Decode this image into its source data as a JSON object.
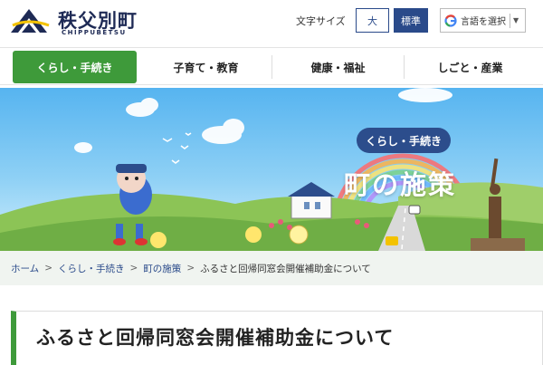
{
  "header": {
    "site_title": "秩父別町",
    "site_subtitle": "CHIPPUBETSU",
    "font_size_label": "文字サイズ",
    "font_large_label": "大",
    "font_standard_label": "標準",
    "language_label": "言語を選択",
    "language_arrow": "▼"
  },
  "nav": {
    "items": [
      {
        "label": "くらし・手続き",
        "active": true
      },
      {
        "label": "子育て・教育"
      },
      {
        "label": "健康・福祉"
      },
      {
        "label": "しごと・産業"
      }
    ]
  },
  "hero": {
    "badge": "くらし・手続き",
    "title": "町の施策"
  },
  "breadcrumb": {
    "items": [
      "ホーム",
      "くらし・手続き",
      "町の施策",
      "ふるさと回帰同窓会開催補助金について"
    ],
    "separator": ">"
  },
  "page": {
    "title": "ふるさと回帰同窓会開催補助金について"
  },
  "colors": {
    "brand_navy": "#1e2a55",
    "nav_active": "#3e9a3a",
    "button_blue": "#2a4a8a",
    "badge": "#2c4d8c"
  }
}
